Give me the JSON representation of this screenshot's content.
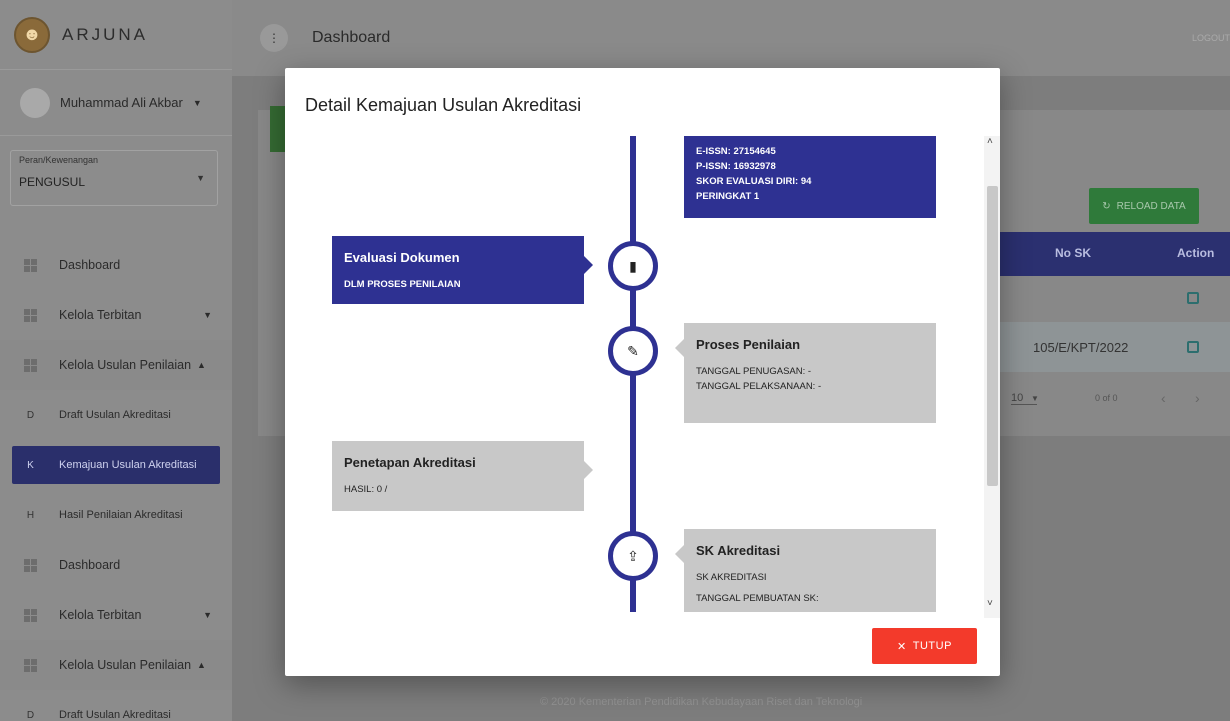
{
  "app": {
    "brand": "ARJUNA",
    "user_name": "Muhammad Ali Akbar"
  },
  "role": {
    "label": "Peran/Kewenangan",
    "value": "PENGUSUL"
  },
  "sidebar": {
    "items": [
      {
        "label": "Dashboard"
      },
      {
        "label": "Kelola Terbitan"
      },
      {
        "label": "Kelola Usulan Penilaian"
      },
      {
        "letter": "D",
        "label": "Draft Usulan Akreditasi"
      },
      {
        "letter": "K",
        "label": "Kemajuan Usulan Akreditasi"
      },
      {
        "letter": "H",
        "label": "Hasil Penilaian Akreditasi"
      },
      {
        "label": "Dashboard"
      },
      {
        "label": "Kelola Terbitan"
      },
      {
        "label": "Kelola Usulan Penilaian"
      },
      {
        "letter": "D",
        "label": "Draft Usulan Akreditasi"
      }
    ]
  },
  "header": {
    "title": "Dashboard",
    "logout": "LOGOUT"
  },
  "background": {
    "reload_label": "RELOAD DATA",
    "col_nosk": "No SK",
    "col_action": "Action",
    "row2_nosk": "105/E/KPT/2022",
    "page_size": "10",
    "page_count": "0 of 0",
    "footer": "© 2020 Kementerian Pendidikan Kebudayaan Riset dan Teknologi"
  },
  "modal": {
    "title": "Detail Kemajuan Usulan Akreditasi",
    "close_label": "TUTUP",
    "card_top": {
      "lines": [
        "E-ISSN: 27154645",
        "P-ISSN: 16932978",
        "SKOR EVALUASI DIRI: 94",
        "PERINGKAT 1"
      ]
    },
    "card_evaluasi": {
      "title": "Evaluasi Dokumen",
      "status": "DLM PROSES PENILAIAN"
    },
    "card_proses": {
      "title": "Proses Penilaian",
      "line1": "TANGGAL PENUGASAN: -",
      "line2": "TANGGAL PELAKSANAAN: -"
    },
    "card_penetapan": {
      "title": "Penetapan Akreditasi",
      "status": "HASIL: 0 /"
    },
    "card_sk": {
      "title": "SK Akreditasi",
      "line1": "SK AKREDITASI",
      "line2": "TANGGAL PEMBUATAN SK:"
    }
  },
  "colors": {
    "accent": "#2e3192",
    "danger": "#f33a2b",
    "success": "#2f7a3a"
  }
}
